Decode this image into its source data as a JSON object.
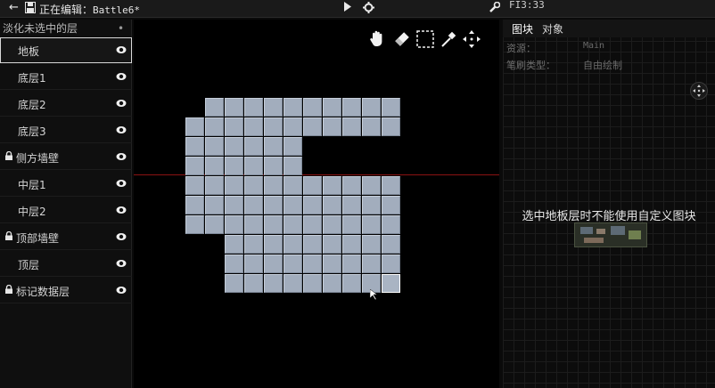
{
  "topbar": {
    "back_icon": "back-arrow-icon",
    "save_icon": "save-disk-icon",
    "editing_label": "正在编辑：",
    "file_name": "Battle6*",
    "play_icon": "play-icon",
    "settings_icon": "gear-icon",
    "wrench_icon": "wrench-icon",
    "time": "FI3:33"
  },
  "layers": {
    "header": "淡化未选中的层",
    "header_toggle": "•",
    "items": [
      {
        "label": "地板",
        "locked": false,
        "selected": true
      },
      {
        "label": "底层1",
        "locked": false,
        "selected": false
      },
      {
        "label": "底层2",
        "locked": false,
        "selected": false
      },
      {
        "label": "底层3",
        "locked": false,
        "selected": false
      },
      {
        "label": "侧方墙壁",
        "locked": true,
        "selected": false
      },
      {
        "label": "中层1",
        "locked": false,
        "selected": false
      },
      {
        "label": "中层2",
        "locked": false,
        "selected": false
      },
      {
        "label": "顶部墙壁",
        "locked": true,
        "selected": false
      },
      {
        "label": "顶层",
        "locked": false,
        "selected": false
      },
      {
        "label": "标记数据层",
        "locked": true,
        "selected": false
      }
    ]
  },
  "canvas": {
    "tools": [
      "hand-tool-icon",
      "eraser-tool-icon",
      "select-rect-tool-icon",
      "eyedropper-tool-icon",
      "center-view-icon"
    ]
  },
  "right_panel": {
    "tabs": [
      "图块",
      "对象"
    ],
    "active_tab": "图块",
    "source_label": "资源：",
    "source_value": "Main",
    "brush_label": "笔刷类型：",
    "brush_value": "自由绘制",
    "message": "选中地板层时不能使用自定义图块"
  }
}
